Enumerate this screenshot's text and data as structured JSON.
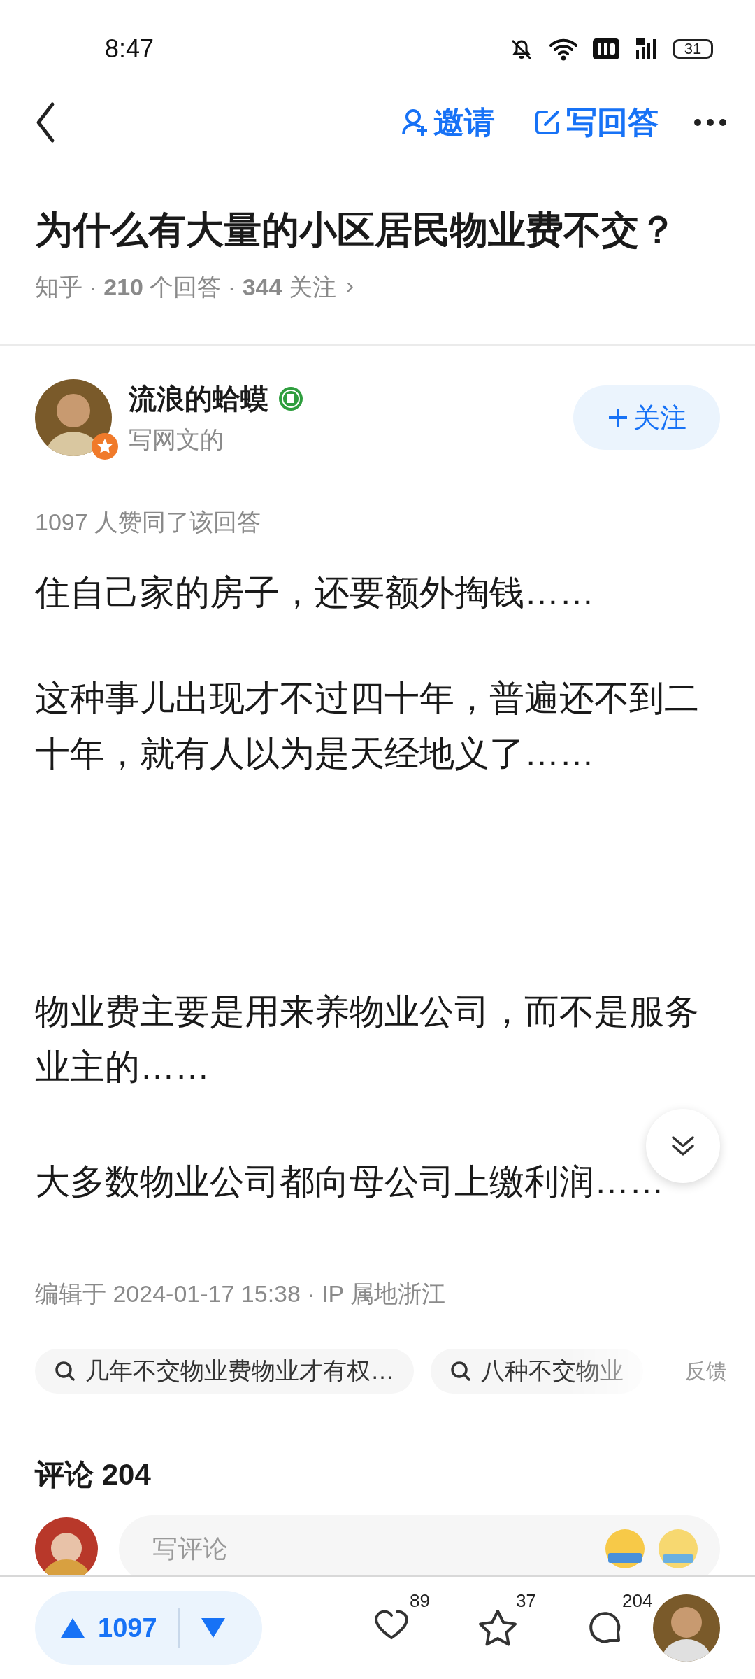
{
  "status_bar": {
    "time": "8:47",
    "battery": "31"
  },
  "nav": {
    "actions": [
      {
        "kind": "invite",
        "label": "邀请"
      },
      {
        "kind": "write",
        "label": "写回答"
      }
    ]
  },
  "question": {
    "title": "为什么有大量的小区居民物业费不交？",
    "meta": "知乎 · **210** 个回答 · **344** 关注",
    "chevron": "›"
  },
  "author": {
    "name": "流浪的蛤蟆",
    "bio": "写网文的",
    "follow_label": "关注"
  },
  "upvote_note": "1097 人赞同了该回答",
  "sections": [
    [
      "住自己家的房子，还要额外掏钱……",
      "这种事儿出现才不过四十年，普遍还不到二十年，就有人以为是天经地义了……"
    ],
    [
      "物业费主要是用来养物业公司，而不是服务业主的……",
      "大多数物业公司都向母公司上缴利润……"
    ]
  ],
  "edited": "编辑于 2024-01-17 15:38 · IP 属地浙江",
  "related_searches": [
    {
      "text": "几年不交物业费物业才有权…"
    },
    {
      "text": "八种不交物业"
    }
  ],
  "feedback": "反馈",
  "comments": {
    "title": "评论 204",
    "placeholder": "写评论"
  },
  "bottom_bar": {
    "votes": "1097",
    "actions": [
      {
        "kind": "like",
        "count": "89"
      },
      {
        "kind": "favorite",
        "count": "37"
      },
      {
        "kind": "comment",
        "count": "204"
      }
    ]
  }
}
